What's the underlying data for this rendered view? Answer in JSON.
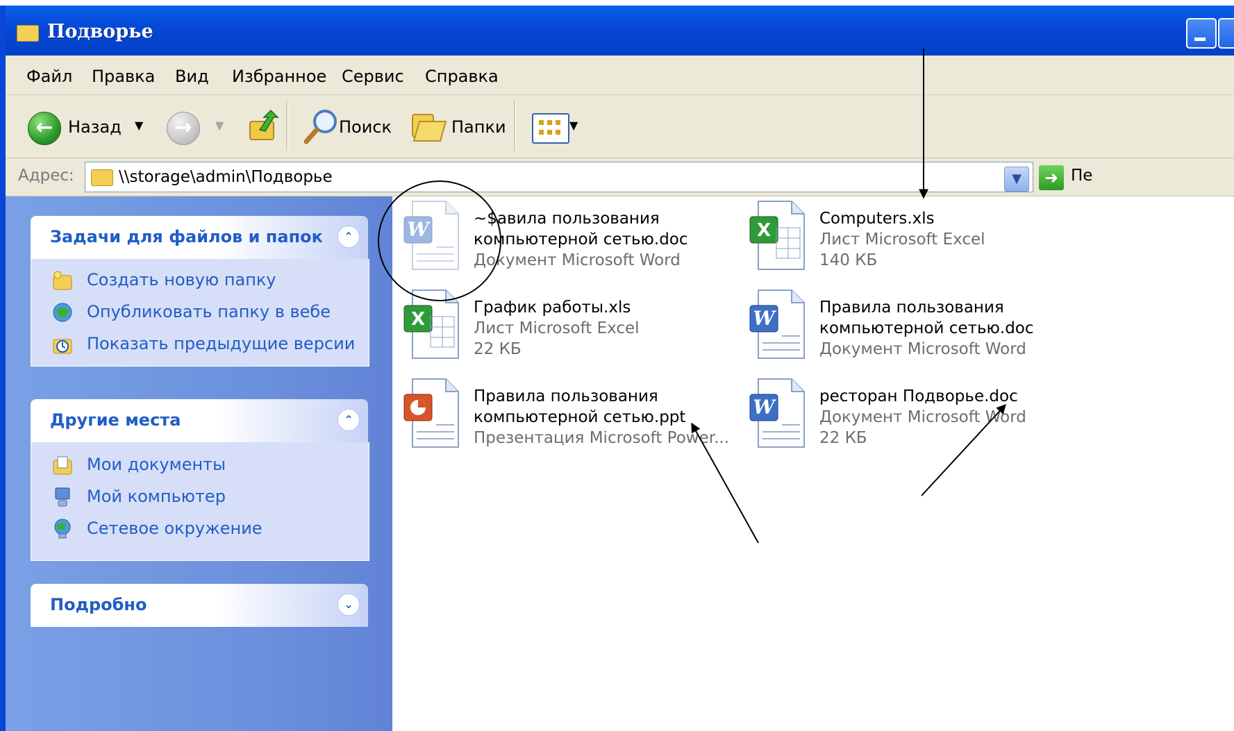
{
  "window": {
    "title": "Подворье"
  },
  "menu": [
    "Файл",
    "Правка",
    "Вид",
    "Избранное",
    "Сервис",
    "Справка"
  ],
  "toolbar": {
    "back_label": "Назад",
    "search_label": "Поиск",
    "folders_label": "Папки"
  },
  "address": {
    "label": "Адрес:",
    "path": "\\\\storage\\admin\\Подворье",
    "go_label": "Пе"
  },
  "panels": {
    "tasks": {
      "title": "Задачи для файлов и папок",
      "items": [
        {
          "label": "Создать новую папку",
          "icon": "new-folder-icon"
        },
        {
          "label": "Опубликовать папку в вебе",
          "icon": "web-publish-icon"
        },
        {
          "label": "Показать предыдущие версии",
          "icon": "previous-versions-icon"
        }
      ]
    },
    "places": {
      "title": "Другие места",
      "items": [
        {
          "label": "Мои документы",
          "icon": "my-documents-icon"
        },
        {
          "label": "Мой компьютер",
          "icon": "my-computer-icon"
        },
        {
          "label": "Сетевое окружение",
          "icon": "network-icon"
        }
      ]
    },
    "details": {
      "title": "Подробно"
    }
  },
  "files": [
    {
      "name1": "~$авила пользования",
      "name2": "компьютерной сетью.doc",
      "type": "Документ Microsoft Word",
      "size": "",
      "icon": "word-doc-icon",
      "ghost": true
    },
    {
      "name1": "Computers.xls",
      "name2": "",
      "type": "Лист Microsoft Excel",
      "size": "140 КБ",
      "icon": "excel-doc-icon"
    },
    {
      "name1": "График работы.xls",
      "name2": "",
      "type": "Лист Microsoft Excel",
      "size": "22 КБ",
      "icon": "excel-doc-icon"
    },
    {
      "name1": "Правила пользования",
      "name2": "компьютерной сетью.doc",
      "type": "Документ Microsoft Word",
      "size": "",
      "icon": "word-doc-icon"
    },
    {
      "name1": "Правила пользования",
      "name2": "компьютерной сетью.ppt",
      "type": "Презентация Microsoft Power...",
      "size": "",
      "icon": "powerpoint-doc-icon"
    },
    {
      "name1": "ресторан Подворье.doc",
      "name2": "",
      "type": "Документ Microsoft Word",
      "size": "22 КБ",
      "icon": "word-doc-icon"
    }
  ],
  "colors": {
    "title_bar": "#0a5fe8",
    "task_pane": "#6a8fdc",
    "link_text": "#215dc6",
    "toolbar": "#ece9d8"
  }
}
